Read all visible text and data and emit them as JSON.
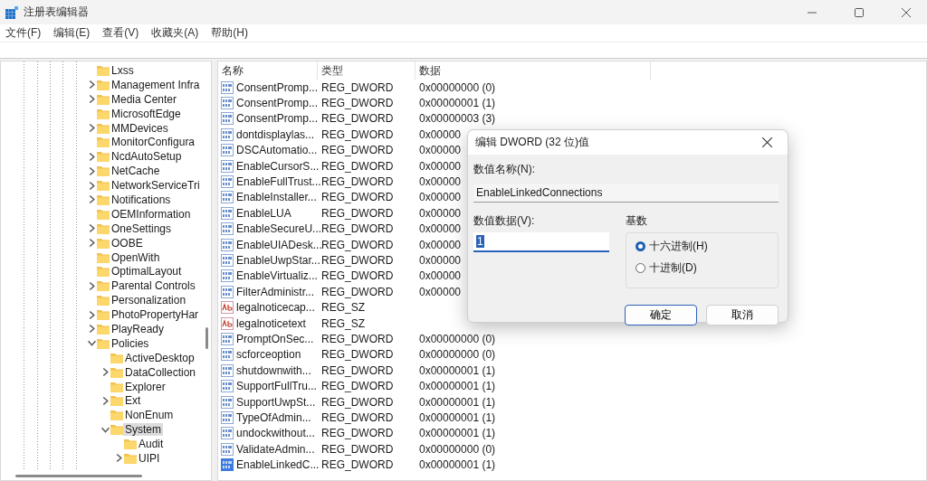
{
  "window": {
    "title": "注册表编辑器"
  },
  "menu": [
    "文件(F)",
    "编辑(E)",
    "查看(V)",
    "收藏夹(A)",
    "帮助(H)"
  ],
  "tree": [
    {
      "label": "Lxss",
      "selected": false
    },
    {
      "label": "Management Infra",
      "expanded": false,
      "selected": false
    },
    {
      "label": "Media Center",
      "expanded": false,
      "selected": false
    },
    {
      "label": "MicrosoftEdge",
      "selected": false
    },
    {
      "label": "MMDevices",
      "expanded": false,
      "selected": false
    },
    {
      "label": "MonitorConfigura",
      "selected": false
    },
    {
      "label": "NcdAutoSetup",
      "expanded": false,
      "selected": false
    },
    {
      "label": "NetCache",
      "expanded": false,
      "selected": false
    },
    {
      "label": "NetworkServiceTri",
      "expanded": false,
      "selected": false
    },
    {
      "label": "Notifications",
      "expanded": false,
      "selected": false
    },
    {
      "label": "OEMInformation",
      "selected": false
    },
    {
      "label": "OneSettings",
      "expanded": false,
      "selected": false
    },
    {
      "label": "OOBE",
      "expanded": false,
      "selected": false
    },
    {
      "label": "OpenWith",
      "selected": false
    },
    {
      "label": "OptimalLayout",
      "selected": false
    },
    {
      "label": "Parental Controls",
      "expanded": false,
      "selected": false
    },
    {
      "label": "Personalization",
      "selected": false
    },
    {
      "label": "PhotoPropertyHar",
      "expanded": false,
      "selected": false
    },
    {
      "label": "PlayReady",
      "expanded": false,
      "selected": false
    },
    {
      "label": "Policies",
      "expanded": true,
      "selected": false,
      "children": [
        {
          "label": "ActiveDesktop",
          "selected": false
        },
        {
          "label": "DataCollection",
          "expanded": false,
          "selected": false
        },
        {
          "label": "Explorer",
          "selected": false
        },
        {
          "label": "Ext",
          "expanded": false,
          "selected": false
        },
        {
          "label": "NonEnum",
          "selected": false
        },
        {
          "label": "System",
          "expanded": true,
          "selected": true,
          "children": [
            {
              "label": "Audit",
              "selected": false
            },
            {
              "label": "UIPI",
              "expanded": false,
              "selected": false
            }
          ]
        }
      ]
    }
  ],
  "list": {
    "columns": [
      "名称",
      "类型",
      "数据"
    ],
    "rows": [
      {
        "kind": "dword",
        "name": "ConsentPromp...",
        "type": "REG_DWORD",
        "data": "0x00000000 (0)",
        "selected": false
      },
      {
        "kind": "dword",
        "name": "ConsentPromp...",
        "type": "REG_DWORD",
        "data": "0x00000001 (1)",
        "selected": false
      },
      {
        "kind": "dword",
        "name": "ConsentPromp...",
        "type": "REG_DWORD",
        "data": "0x00000003 (3)",
        "selected": false
      },
      {
        "kind": "dword",
        "name": "dontdisplaylas...",
        "type": "REG_DWORD",
        "data": "0x00000",
        "selected": false
      },
      {
        "kind": "dword",
        "name": "DSCAutomatio...",
        "type": "REG_DWORD",
        "data": "0x00000",
        "selected": false
      },
      {
        "kind": "dword",
        "name": "EnableCursorS...",
        "type": "REG_DWORD",
        "data": "0x00000",
        "selected": false
      },
      {
        "kind": "dword",
        "name": "EnableFullTrust...",
        "type": "REG_DWORD",
        "data": "0x00000",
        "selected": false
      },
      {
        "kind": "dword",
        "name": "EnableInstaller...",
        "type": "REG_DWORD",
        "data": "0x00000",
        "selected": false
      },
      {
        "kind": "dword",
        "name": "EnableLUA",
        "type": "REG_DWORD",
        "data": "0x00000",
        "selected": false
      },
      {
        "kind": "dword",
        "name": "EnableSecureU...",
        "type": "REG_DWORD",
        "data": "0x00000",
        "selected": false
      },
      {
        "kind": "dword",
        "name": "EnableUIADesk...",
        "type": "REG_DWORD",
        "data": "0x00000",
        "selected": false
      },
      {
        "kind": "dword",
        "name": "EnableUwpStar...",
        "type": "REG_DWORD",
        "data": "0x00000",
        "selected": false
      },
      {
        "kind": "dword",
        "name": "EnableVirtualiz...",
        "type": "REG_DWORD",
        "data": "0x00000",
        "selected": false
      },
      {
        "kind": "dword",
        "name": "FilterAdministr...",
        "type": "REG_DWORD",
        "data": "0x00000",
        "selected": false
      },
      {
        "kind": "string",
        "name": "legalnoticecap...",
        "type": "REG_SZ",
        "selected": false
      },
      {
        "kind": "string",
        "name": "legalnoticetext",
        "type": "REG_SZ",
        "selected": false
      },
      {
        "kind": "dword",
        "name": "PromptOnSec...",
        "type": "REG_DWORD",
        "data": "0x00000000 (0)",
        "selected": false
      },
      {
        "kind": "dword",
        "name": "scforceoption",
        "type": "REG_DWORD",
        "data": "0x00000000 (0)",
        "selected": false
      },
      {
        "kind": "dword",
        "name": "shutdownwith...",
        "type": "REG_DWORD",
        "data": "0x00000001 (1)",
        "selected": false
      },
      {
        "kind": "dword",
        "name": "SupportFullTru...",
        "type": "REG_DWORD",
        "data": "0x00000001 (1)",
        "selected": false
      },
      {
        "kind": "dword",
        "name": "SupportUwpSt...",
        "type": "REG_DWORD",
        "data": "0x00000001 (1)",
        "selected": false
      },
      {
        "kind": "dword",
        "name": "TypeOfAdmin...",
        "type": "REG_DWORD",
        "data": "0x00000001 (1)",
        "selected": false
      },
      {
        "kind": "dword",
        "name": "undockwithout...",
        "type": "REG_DWORD",
        "data": "0x00000001 (1)",
        "selected": false
      },
      {
        "kind": "dword",
        "name": "ValidateAdmin...",
        "type": "REG_DWORD",
        "data": "0x00000000 (0)",
        "selected": false
      },
      {
        "kind": "dword",
        "name": "EnableLinkedC...",
        "type": "REG_DWORD",
        "data": "0x00000001 (1)",
        "selected": true
      }
    ]
  },
  "dialog": {
    "title": "编辑 DWORD (32 位)值",
    "name_label": "数值名称(N):",
    "name_value": "EnableLinkedConnections",
    "data_label": "数值数据(V):",
    "data_value": "1",
    "base_label": "基数",
    "bases": [
      {
        "label": "十六进制(H)",
        "selected": true
      },
      {
        "label": "十进制(D)",
        "selected": false
      }
    ],
    "buttons": [
      {
        "label": "确定",
        "default": true
      },
      {
        "label": "取消",
        "default": false
      }
    ]
  }
}
